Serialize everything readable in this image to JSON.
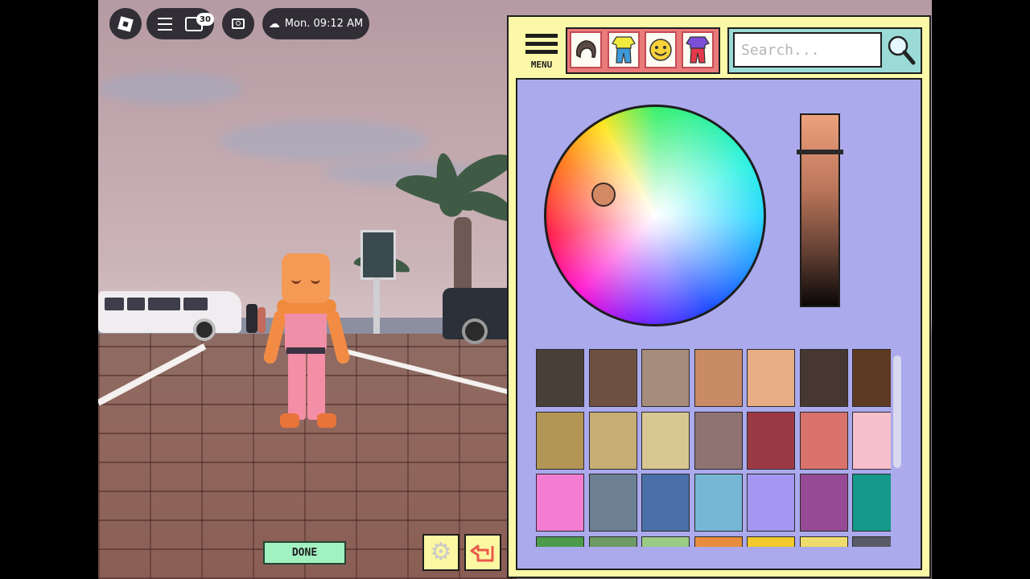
{
  "hud": {
    "chat_badge": "30",
    "time": "Mon. 09:12 AM"
  },
  "editor": {
    "menu_label": "MENU",
    "categories": [
      {
        "icon": "hair-icon"
      },
      {
        "icon": "clothing-icon"
      },
      {
        "icon": "face-icon"
      },
      {
        "icon": "outfit-icon"
      }
    ],
    "search_placeholder": "Search...",
    "selected_color": "#d38a64",
    "swatches": [
      [
        "#4a3f36",
        "#6e5041",
        "#a58c7c",
        "#c98a66",
        "#e7ad85",
        "#463730",
        "#5e3a23"
      ],
      [
        "#b39656",
        "#c8ad74",
        "#d8c792",
        "#8f7372",
        "#9b3a45",
        "#d8726a",
        "#f7bfcb"
      ],
      [
        "#f47dd2",
        "#6c7f93",
        "#4b6fa8",
        "#76b7d6",
        "#a596f2",
        "#964a96",
        "#14998b"
      ],
      [
        "#4b9b4a",
        "#6d9a65",
        "#9ccb85",
        "#e78c3e",
        "#f2c92c",
        "#f0dc6d",
        "#585a66"
      ]
    ],
    "done_label": "DONE"
  }
}
